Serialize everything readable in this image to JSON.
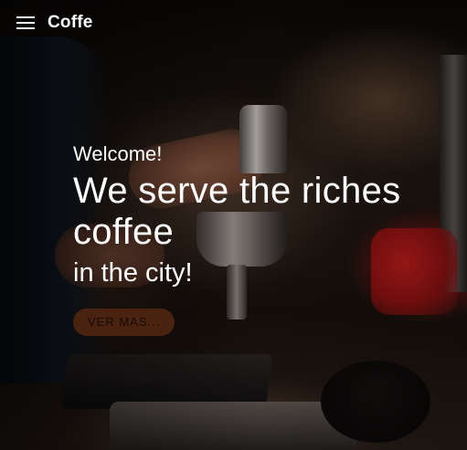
{
  "app": {
    "title": "Coffe",
    "menu_icon": "menu-icon"
  },
  "hero": {
    "welcome": "Welcome!",
    "headline": "We serve the riches coffee",
    "subline": "in the city!",
    "cta_label": "VER MAS..."
  },
  "colors": {
    "text": "#ffffff",
    "cta_background": "#4a2210",
    "cta_text": "#180a04"
  }
}
